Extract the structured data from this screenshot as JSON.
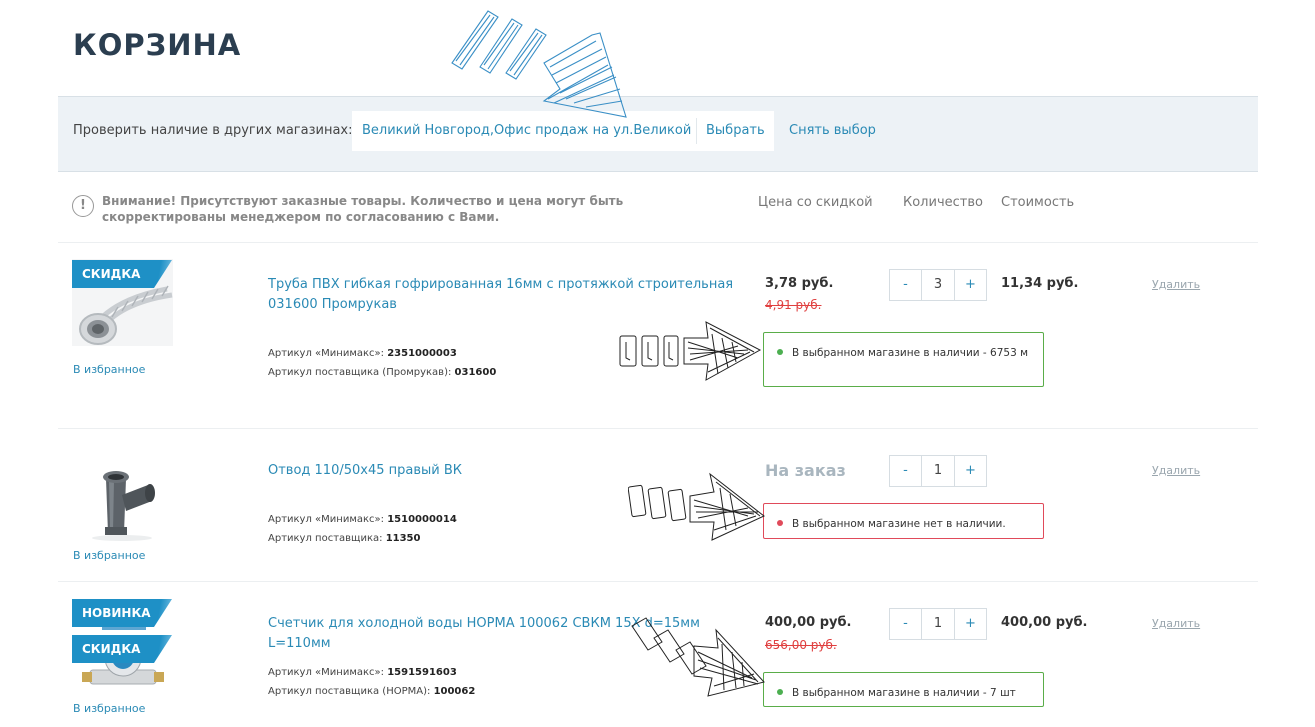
{
  "page": {
    "title": "КОРЗИНА"
  },
  "store_check": {
    "label": "Проверить наличие в других магазинах:",
    "selected_store": "Великий Новгород,Офис продаж на ул.Великой",
    "choose_label": "Выбрать",
    "reset_label": "Снять выбор"
  },
  "notice": {
    "icon": "!",
    "text": "Внимание! Присутствуют заказные товары. Количество и цена могут быть скорректированы менеджером по согласованию с Вами."
  },
  "columns": {
    "price": "Цена со скидкой",
    "qty": "Количество",
    "total": "Стоимость"
  },
  "items": [
    {
      "badges": [
        "СКИДКА"
      ],
      "favorite": "В избранное",
      "name": "Труба ПВХ гибкая гофрированная 16мм с протяжкой строительная 031600 Промрукав",
      "art_label": "Артикул «Минимакс»:",
      "art": "2351000003",
      "vendor_label": "Артикул поставщика (Промрукав):",
      "vendor": "031600",
      "price": "3,78 руб.",
      "old_price": "4,91 руб.",
      "minus": "-",
      "qty": "3",
      "plus": "+",
      "total": "11,34 руб.",
      "delete": "Удалить",
      "stock": "В выбранном магазине в наличии - 6753 м",
      "stock_status": "available"
    },
    {
      "badges": [],
      "favorite": "В избранное",
      "name": "Отвод 110/50х45 правый ВК",
      "art_label": "Артикул «Минимакс»:",
      "art": "1510000014",
      "vendor_label": "Артикул поставщика:",
      "vendor": "11350",
      "price_status": "На заказ",
      "minus": "-",
      "qty": "1",
      "plus": "+",
      "delete": "Удалить",
      "stock": "В выбранном магазине нет в наличии.",
      "stock_status": "unavailable"
    },
    {
      "badges": [
        "НОВИНКА",
        "СКИДКА"
      ],
      "favorite": "В избранное",
      "name": "Счетчик для холодной воды НОРМА 100062 СВКМ 15Х d=15мм L=110мм",
      "art_label": "Артикул «Минимакс»:",
      "art": "1591591603",
      "vendor_label": "Артикул поставщика (НОРМА):",
      "vendor": "100062",
      "price": "400,00 руб.",
      "old_price": "656,00 руб.",
      "minus": "-",
      "qty": "1",
      "plus": "+",
      "total": "400,00 руб.",
      "delete": "Удалить",
      "stock": "В выбранном магазине в наличии - 7 шт",
      "stock_status": "available"
    }
  ],
  "colors": {
    "link": "#2a8ab5",
    "badge": "#1e90c6",
    "in_stock": "#5aad49",
    "out_of_stock": "#e04a5a",
    "old_price": "#e04040"
  },
  "annotations": [
    "hand-drawn-arrow-icon",
    "hand-drawn-arrow-icon",
    "hand-drawn-arrow-icon",
    "hand-drawn-arrow-icon"
  ]
}
